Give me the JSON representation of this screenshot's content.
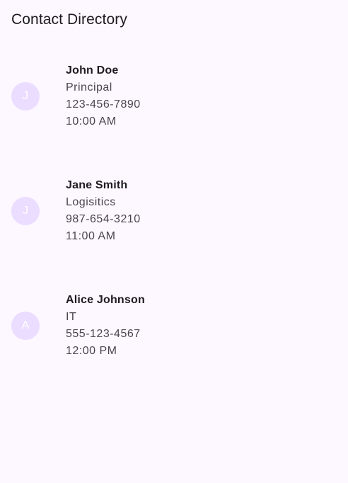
{
  "app_bar": {
    "title": "Contact Directory"
  },
  "colors": {
    "background": "#fdf7ff",
    "avatar_background": "#eaddff",
    "avatar_text": "#ffffff",
    "primary_text": "#1d1b20",
    "secondary_text": "#49454f"
  },
  "contacts": [
    {
      "initial": "J",
      "name": "John Doe",
      "department": "Principal",
      "phone": "123-456-7890",
      "time": "10:00 AM"
    },
    {
      "initial": "J",
      "name": "Jane Smith",
      "department": "Logisitics",
      "phone": "987-654-3210",
      "time": "11:00 AM"
    },
    {
      "initial": "A",
      "name": "Alice Johnson",
      "department": "IT",
      "phone": "555-123-4567",
      "time": "12:00 PM"
    }
  ]
}
